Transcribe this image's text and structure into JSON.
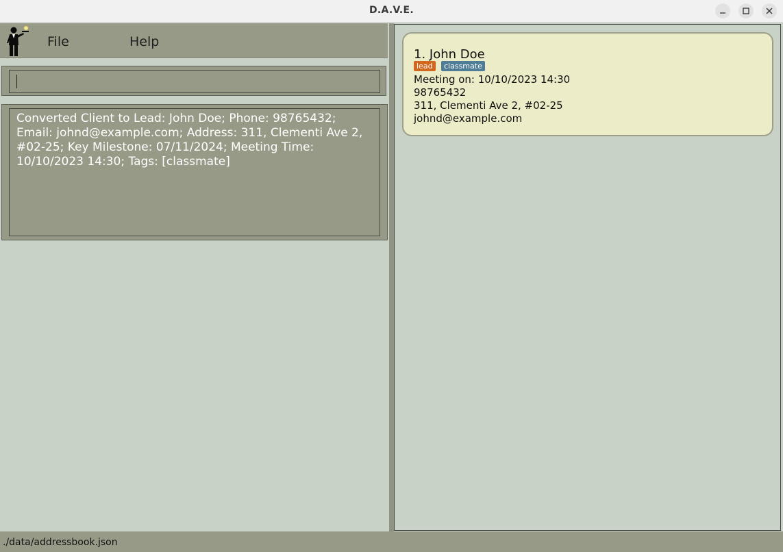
{
  "window": {
    "title": "D.A.V.E.",
    "buttons": {
      "minimize": "minimize-icon",
      "maximize": "maximize-icon",
      "close": "close-icon"
    }
  },
  "menu": {
    "logo_icon": "butler-icon",
    "file_label": "File",
    "help_label": "Help"
  },
  "command_box": {
    "value": ""
  },
  "result_display": {
    "text": "Converted Client to Lead: John Doe; Phone: 98765432; Email: johnd@example.com; Address: 311, Clementi Ave 2, #02-25; Key Milestone: 07/11/2024; Meeting Time: 10/10/2023 14:30; Tags: [classmate]"
  },
  "person_list": [
    {
      "index_name": "1.  John Doe",
      "tags": [
        "lead",
        "classmate"
      ],
      "meeting": "Meeting on: 10/10/2023 14:30",
      "phone": "98765432",
      "address": "311, Clementi Ave 2, #02-25",
      "email": "johnd@example.com"
    }
  ],
  "status_bar": {
    "path": "./data/addressbook.json"
  },
  "colors": {
    "background": "#c9d2c6",
    "panel": "#979a87",
    "card": "#ececc8",
    "tag_lead": "#d2671f",
    "tag_classmate": "#4f7d98"
  }
}
